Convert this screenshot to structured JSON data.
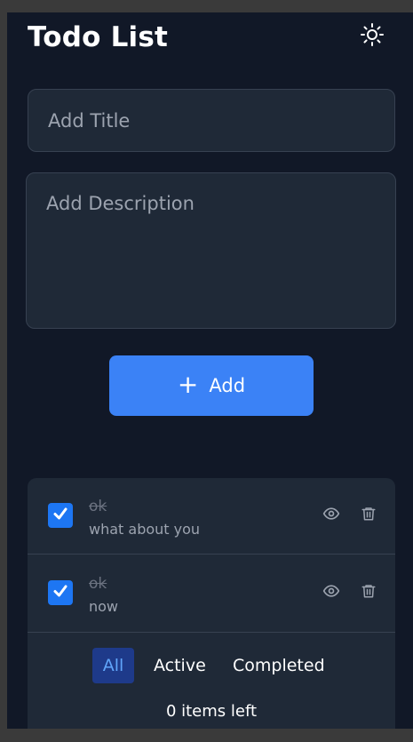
{
  "header": {
    "title": "Todo List",
    "theme_icon": "sun-icon"
  },
  "form": {
    "title_placeholder": "Add Title",
    "description_placeholder": "Add Description",
    "add_label": "Add",
    "add_icon": "plus-icon"
  },
  "todos": [
    {
      "title": "ok",
      "description": "what about you",
      "completed": true
    },
    {
      "title": "ok",
      "description": "now",
      "completed": true
    }
  ],
  "filters": {
    "all": "All",
    "active": "Active",
    "completed": "Completed",
    "selected": "All"
  },
  "footer": {
    "items_left": "0 items left"
  },
  "colors": {
    "background": "#111827",
    "card": "#1f2937",
    "accent": "#3b82f6",
    "checkbox": "#1d76f3",
    "filter_active_bg": "#1e3a8a",
    "filter_active_text": "#60a5fa"
  }
}
